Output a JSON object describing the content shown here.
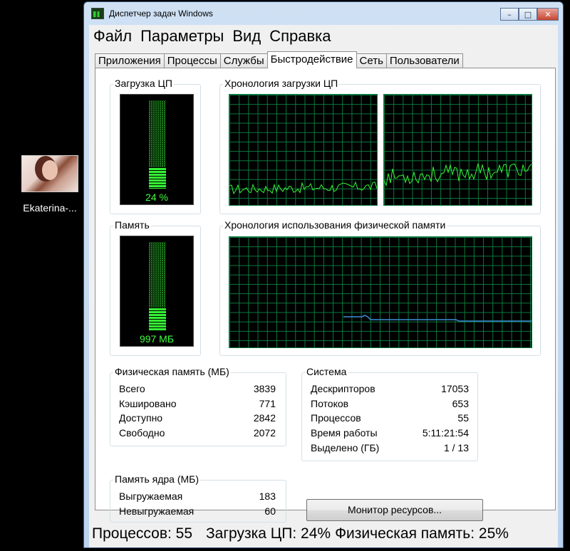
{
  "desktop": {
    "icon_label": "Ekaterina-..."
  },
  "window": {
    "title": "Диспетчер задач Windows",
    "buttons": {
      "minimize": "–",
      "maximize": "□",
      "close": "✕"
    }
  },
  "menu": [
    "Файл",
    "Параметры",
    "Вид",
    "Справка"
  ],
  "tabs": [
    "Приложения",
    "Процессы",
    "Службы",
    "Быстродействие",
    "Сеть",
    "Пользователи"
  ],
  "active_tab": "Быстродействие",
  "groups": {
    "cpu_usage": {
      "label": "Загрузка ЦП",
      "value_text": "24 %",
      "fraction": 0.24
    },
    "cpu_history": {
      "label": "Хронология загрузки ЦП"
    },
    "memory": {
      "label": "Память",
      "value_text": "997 МБ",
      "fraction": 0.26
    },
    "memory_history": {
      "label": "Хронология использования физической памяти"
    }
  },
  "physical_memory": {
    "label": "Физическая память (МБ)",
    "rows": [
      {
        "name": "Всего",
        "value": "3839"
      },
      {
        "name": "Кэшировано",
        "value": "771"
      },
      {
        "name": "Доступно",
        "value": "2842"
      },
      {
        "name": "Свободно",
        "value": "2072"
      }
    ]
  },
  "kernel_memory": {
    "label": "Память ядра (МБ)",
    "rows": [
      {
        "name": "Выгружаемая",
        "value": "183"
      },
      {
        "name": "Невыгружаемая",
        "value": "60"
      }
    ]
  },
  "system": {
    "label": "Система",
    "rows": [
      {
        "name": "Дескрипторов",
        "value": "17053"
      },
      {
        "name": "Потоков",
        "value": "653"
      },
      {
        "name": "Процессов",
        "value": "55"
      },
      {
        "name": "Время работы",
        "value": "5:11:21:54"
      },
      {
        "name": "Выделено (ГБ)",
        "value": "1 / 13"
      }
    ]
  },
  "resource_monitor_button": "Монитор ресурсов...",
  "statusbar": {
    "processes": "Процессов: 55",
    "cpu": "Загрузка ЦП: 24%",
    "memory": "Физическая память: 25%"
  },
  "colors": {
    "graph_green": "#35f535",
    "grid": "#0b7a40",
    "memory_line": "#3a8fd8"
  }
}
